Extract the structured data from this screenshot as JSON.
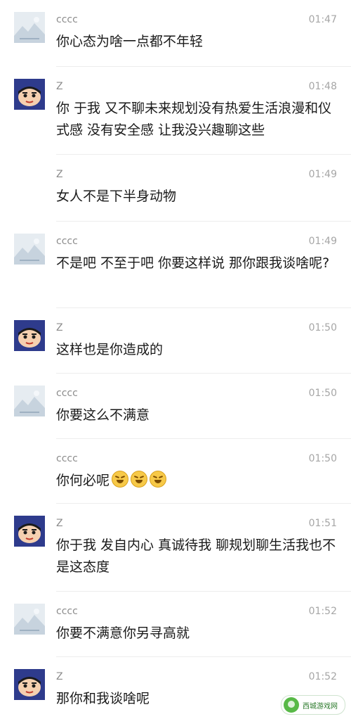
{
  "messages": [
    {
      "name": "cccc",
      "time": "01:47",
      "text": "你心态为啥一点都不年轻",
      "avatar": "landscape-avatar"
    },
    {
      "name": "Z",
      "time": "01:48",
      "text": "你 于我 又不聊未来规划没有热爱生活浪漫和仪式感 没有安全感 让我没兴趣聊这些",
      "avatar": "cartoon-avatar"
    },
    {
      "name": "Z",
      "time": "01:49",
      "text": "女人不是下半身动物",
      "avatar": "none"
    },
    {
      "name": "cccc",
      "time": "01:49",
      "text": "不是吧 不至于吧 你要这样说 那你跟我谈啥呢?",
      "avatar": "landscape-avatar"
    },
    {
      "name": "Z",
      "time": "01:50",
      "text": "这样也是你造成的",
      "avatar": "cartoon-avatar"
    },
    {
      "name": "cccc",
      "time": "01:50",
      "text": "你要这么不满意",
      "avatar": "landscape-avatar"
    },
    {
      "name": "cccc",
      "time": "01:50",
      "text": "你何必呢",
      "emoji_count": 3,
      "emoji": "laughing-tears-emoji",
      "avatar": "none"
    },
    {
      "name": "Z",
      "time": "01:51",
      "text": "你于我 发自内心 真诚待我 聊规划聊生活我也不是这态度",
      "avatar": "cartoon-avatar"
    },
    {
      "name": "cccc",
      "time": "01:52",
      "text": "你要不满意你另寻高就",
      "avatar": "landscape-avatar"
    },
    {
      "name": "Z",
      "time": "01:52",
      "text": "那你和我谈啥呢",
      "avatar": "cartoon-avatar"
    }
  ],
  "watermark": {
    "text": "西城游戏网"
  },
  "colors": {
    "name": "#8c8c8c",
    "time": "#a6a6a6",
    "text": "#1a1a1a",
    "divider": "#ededed",
    "cartoon_bg": "#2e3b8c",
    "landscape_bg": "#e6ecf1"
  }
}
